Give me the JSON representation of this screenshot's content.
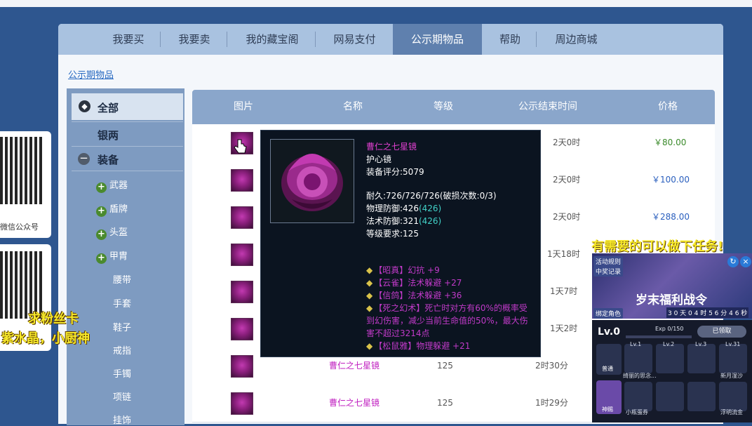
{
  "nav": {
    "tabs": [
      {
        "label": "我要买",
        "active": false
      },
      {
        "label": "我要卖",
        "active": false
      },
      {
        "label": "我的藏宝阁",
        "active": false
      },
      {
        "label": "网易支付",
        "active": false
      },
      {
        "label": "公示期物品",
        "active": true
      },
      {
        "label": "帮助",
        "active": false
      },
      {
        "label": "周边商城",
        "active": false
      }
    ]
  },
  "breadcrumb": "公示期物品",
  "sidebar": {
    "all": "全部",
    "silver": "银两",
    "equipment": "装备",
    "sub": [
      "武器",
      "盾牌",
      "头盔",
      "甲胄",
      "腰带",
      "手套",
      "鞋子",
      "戒指",
      "手镯",
      "项链",
      "挂饰"
    ]
  },
  "table": {
    "headers": [
      "图片",
      "名称",
      "等级",
      "公示结束时间",
      "价格"
    ],
    "rows": [
      {
        "name": "",
        "level": "",
        "time": "2天0时",
        "price": "￥80.00",
        "price_color": "green"
      },
      {
        "name": "",
        "level": "",
        "time": "2天0时",
        "price": "￥100.00",
        "price_color": "blue"
      },
      {
        "name": "",
        "level": "",
        "time": "2天0时",
        "price": "￥288.00",
        "price_color": "blue"
      },
      {
        "name": "",
        "level": "",
        "time": "1天18时",
        "price": "",
        "price_color": "blue"
      },
      {
        "name": "",
        "level": "",
        "time": "1天7时",
        "price": "",
        "price_color": "blue"
      },
      {
        "name": "",
        "level": "",
        "time": "1天2时",
        "price": "",
        "price_color": "blue"
      },
      {
        "name": "曹仁之七星镜",
        "level": "125",
        "time": "2时30分",
        "price": "",
        "price_color": "blue"
      },
      {
        "name": "曹仁之七星镜",
        "level": "125",
        "time": "1时29分",
        "price": "",
        "price_color": "blue"
      }
    ]
  },
  "tooltip": {
    "title": "曹仁之七星镜",
    "type": "护心镜",
    "score": "装备评分:5079",
    "durability": "耐久:726/726/726(破损次数:0/3)",
    "phys_def": "物理防御:426",
    "phys_def_bonus": "(426)",
    "mag_def": "法术防御:321",
    "mag_def_bonus": "(426)",
    "req": "等级要求:125",
    "sets": [
      "【昭真】幻抗 +9",
      "【云雀】法术躲避 +27",
      "【信鸽】法术躲避 +36",
      "【死之幻术】死亡时对方有60%的概率受",
      "到幻伤害，减少当前生命值的50%，最大伤",
      "害不超过3214点",
      "【松鼠雅】物理躲避 +21"
    ]
  },
  "left_ads": {
    "wechat_label": "微信公众号",
    "promo_line1": "求粉丝卡",
    "promo_line2": "紫水晶，小厨神"
  },
  "right_ad": {
    "title": "有需要的可以做下任务!",
    "chip_activity": "活动规则",
    "chip_records": "中奖记录",
    "chip_bind": "绑定角色",
    "banner_text": "岁末福利战令",
    "countdown": "3 0 天 0 4 时 5 6 分 4 6 秒",
    "level": "Lv.0",
    "exp": "Exp 0/150",
    "claimed": "已领取",
    "tier_normal": "普通",
    "tier_god": "神赐",
    "rewards_top": [
      {
        "lv": "Lv.1",
        "name": "绮丽的思念..."
      },
      {
        "lv": "Lv.2",
        "name": ""
      },
      {
        "lv": "Lv.3",
        "name": ""
      },
      {
        "lv": "Lv.31",
        "name": "新月湿沙"
      }
    ],
    "rewards_bottom": [
      {
        "name": "小瓶蛋券"
      },
      {
        "name": ""
      },
      {
        "name": ""
      },
      {
        "name": "浮明流金"
      }
    ]
  },
  "colors": {
    "nav_bg": "#a9c2e0",
    "nav_active": "#5f80ae",
    "item_name": "#c020c0",
    "price_green": "#3a8a2a",
    "price_blue": "#2a5fbe",
    "tooltip_bg": "#0b1420",
    "promo_yellow": "#f6e82a"
  }
}
